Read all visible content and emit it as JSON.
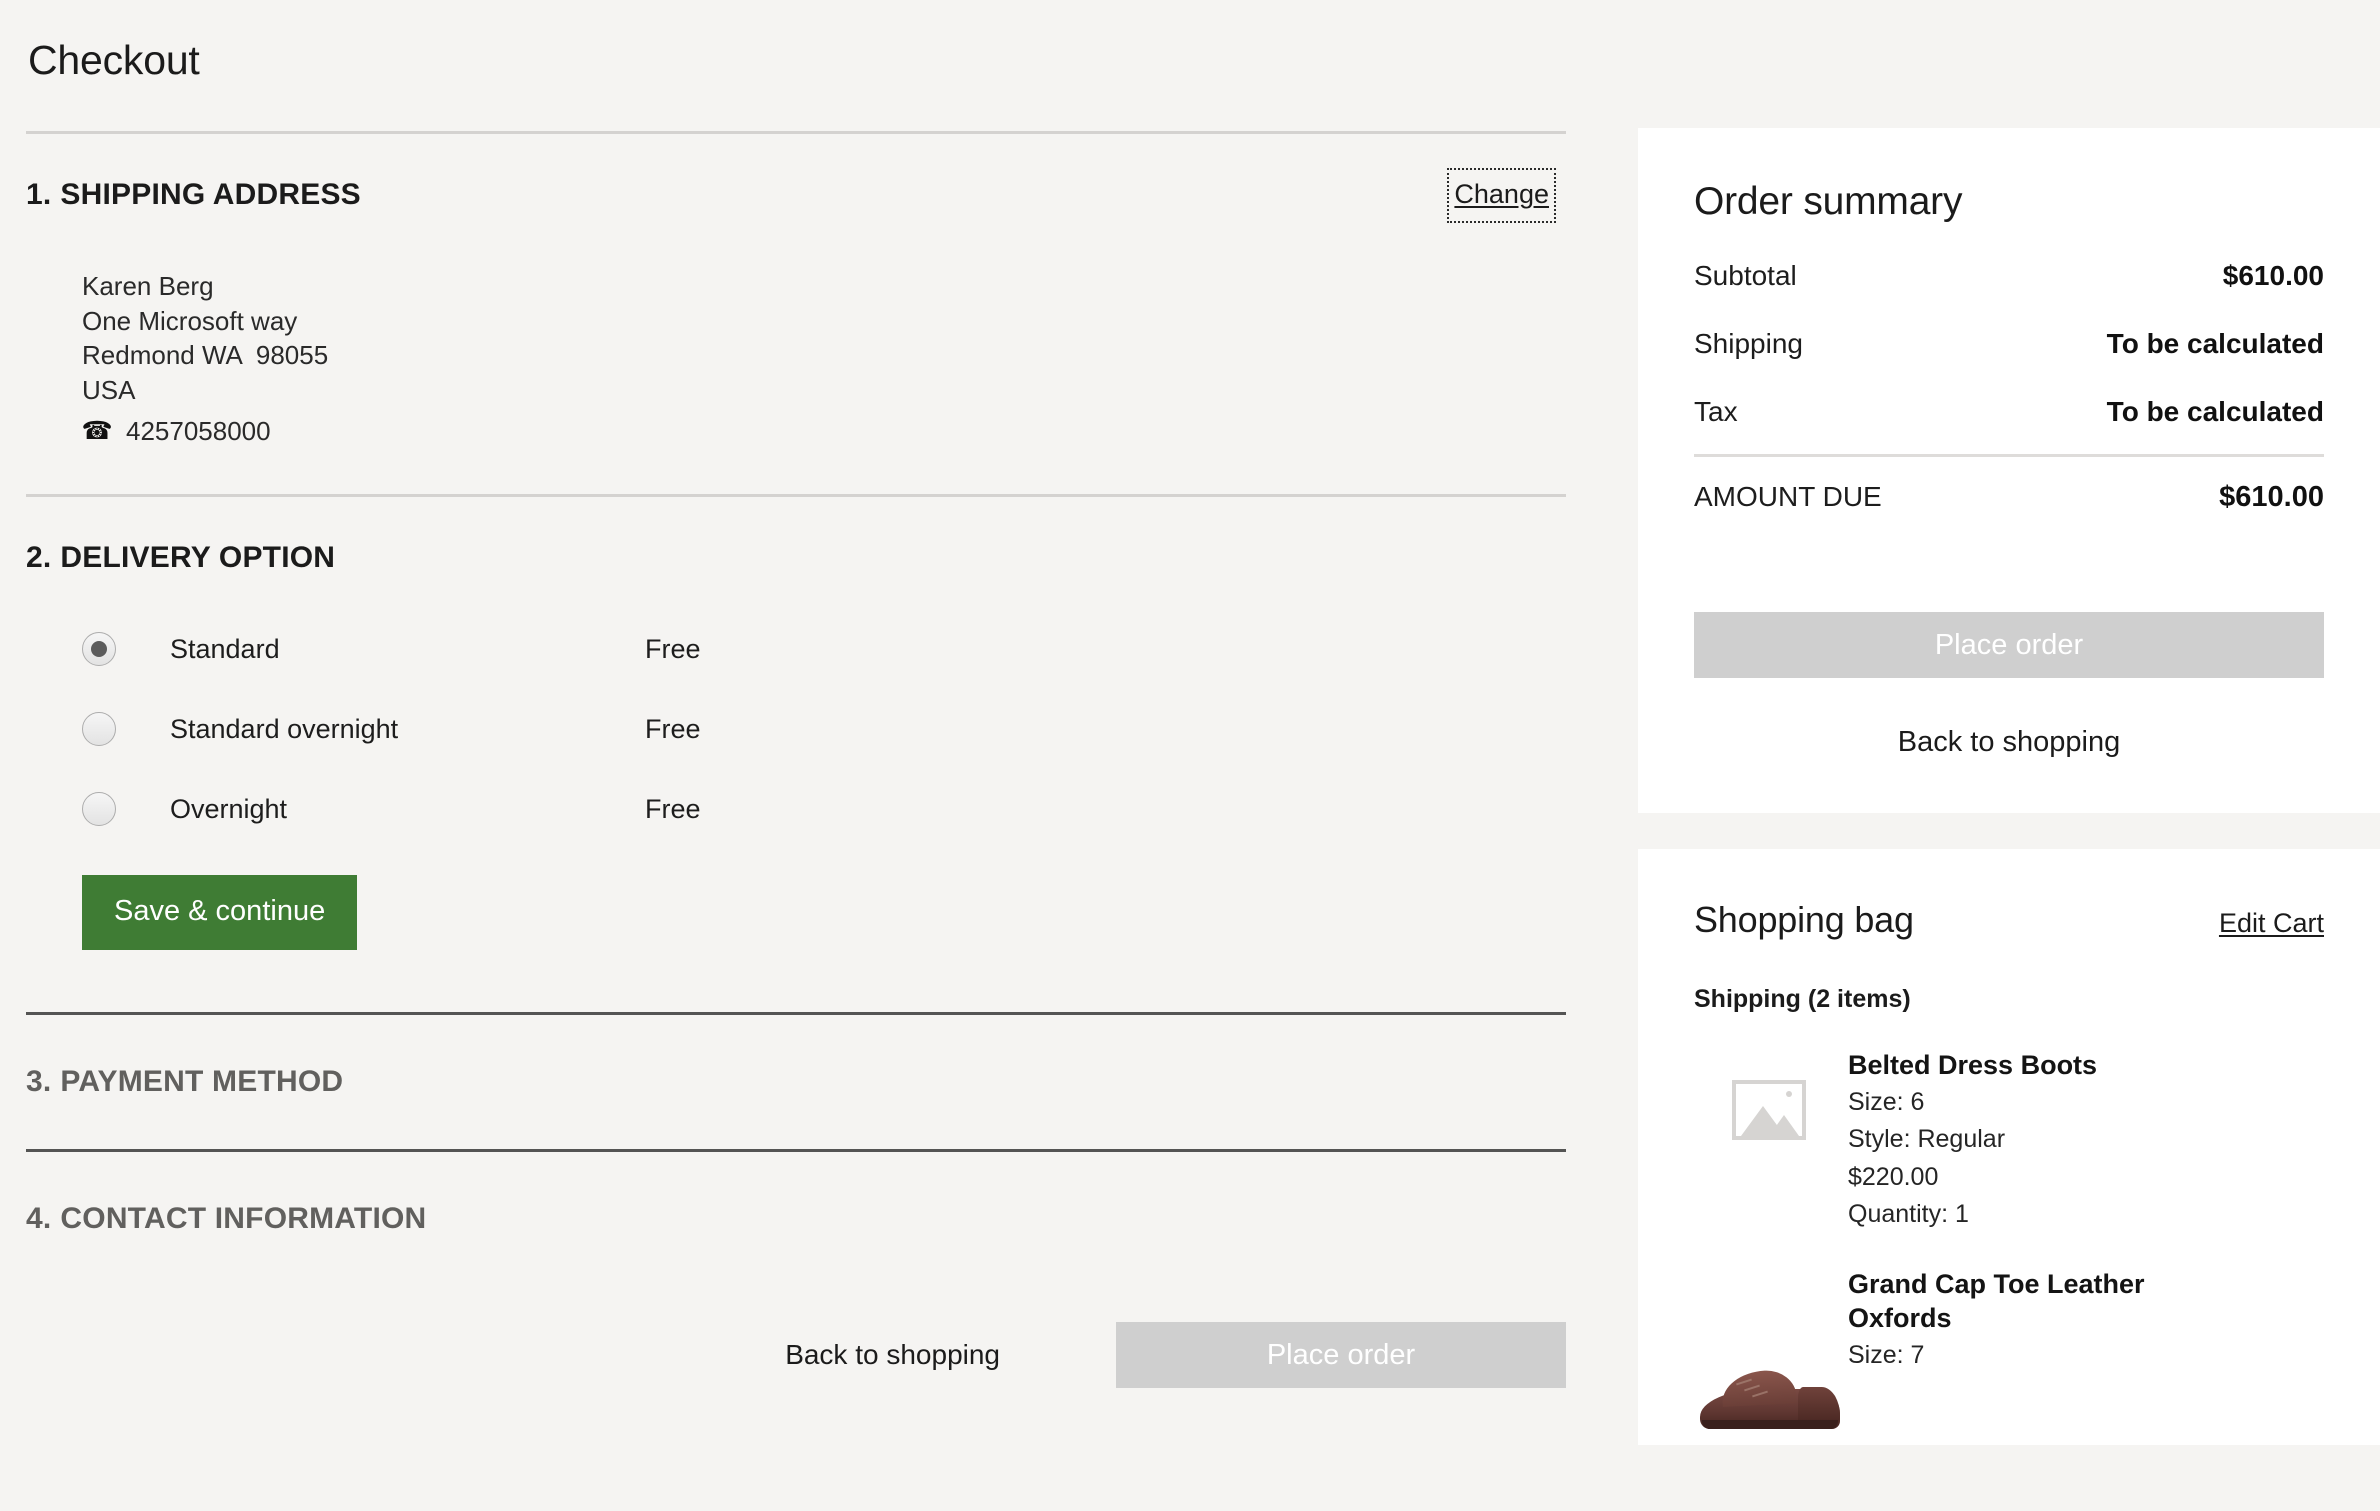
{
  "page": {
    "title": "Checkout"
  },
  "shipping_section": {
    "number": "1.",
    "heading": "SHIPPING ADDRESS",
    "change_label": "Change",
    "address": {
      "name": "Karen Berg",
      "street": "One Microsoft way",
      "city_state_zip": "Redmond WA  98055",
      "country": "USA",
      "phone": "4257058000",
      "phone_icon": "phone-icon"
    }
  },
  "delivery_section": {
    "number": "2.",
    "heading": "DELIVERY OPTION",
    "options": [
      {
        "label": "Standard",
        "price": "Free",
        "selected": true
      },
      {
        "label": "Standard overnight",
        "price": "Free",
        "selected": false
      },
      {
        "label": "Overnight",
        "price": "Free",
        "selected": false
      }
    ],
    "save_label": "Save & continue",
    "save_color": "#3f7c34"
  },
  "payment_section": {
    "number": "3.",
    "heading": "PAYMENT METHOD"
  },
  "contact_section": {
    "number": "4.",
    "heading": "CONTACT INFORMATION"
  },
  "bottom_actions": {
    "back_label": "Back to shopping",
    "place_order_label": "Place order",
    "place_order_color": "#cfcfcf"
  },
  "order_summary": {
    "title": "Order summary",
    "rows": [
      {
        "label": "Subtotal",
        "value": "$610.00"
      },
      {
        "label": "Shipping",
        "value": "To be calculated"
      },
      {
        "label": "Tax",
        "value": "To be calculated"
      }
    ],
    "total": {
      "label": "AMOUNT DUE",
      "value": "$610.00"
    },
    "place_order_label": "Place order",
    "back_label": "Back to shopping"
  },
  "shopping_bag": {
    "title": "Shopping bag",
    "edit_label": "Edit Cart",
    "subheading": "Shipping (2 items)",
    "items": [
      {
        "name": "Belted Dress Boots",
        "size": "Size: 6",
        "style": "Style: Regular",
        "price": "$220.00",
        "quantity": "Quantity: 1",
        "thumb": "image-placeholder-icon"
      },
      {
        "name": "Grand Cap Toe Leather Oxfords",
        "size": "Size: 7",
        "thumb": "oxford-shoe-photo"
      }
    ]
  }
}
